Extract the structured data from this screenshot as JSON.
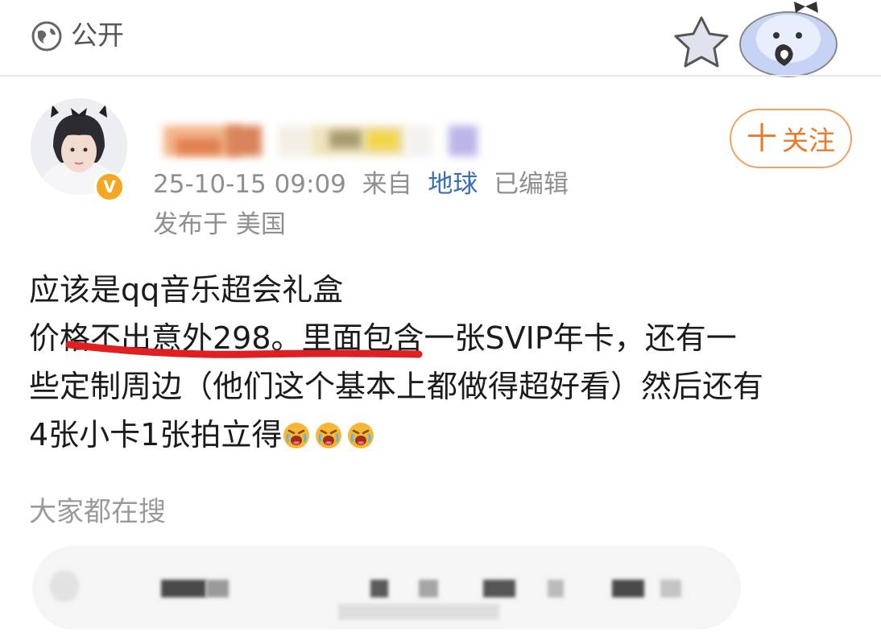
{
  "header": {
    "visibility_label": "公开",
    "visibility_icon": "globe-icon"
  },
  "author": {
    "verified_badge": "V",
    "avatar": "avatar-image"
  },
  "meta": {
    "timestamp": "25-10-15 09:09",
    "from_label": "来自",
    "source": "地球",
    "edited": "已编辑",
    "location": "发布于 美国"
  },
  "follow": {
    "plus": "十",
    "label": "关注"
  },
  "post": {
    "lines": [
      "应该是qq音乐超会礼盒",
      "价格不出意外298。里面包含一张SVIP年卡，还有一",
      "些定制周边（他们这个基本上都做得超好看）然后还有",
      "4张小卡1张拍立得"
    ],
    "emoji_count": 3,
    "emoji": "crying-face-emoji"
  },
  "search": {
    "title": "大家都在搜"
  },
  "colors": {
    "accent_orange": "#ea7a2a",
    "link_blue": "#3b6db3",
    "badge": "#f5a623",
    "annotation_red": "#e02020"
  }
}
